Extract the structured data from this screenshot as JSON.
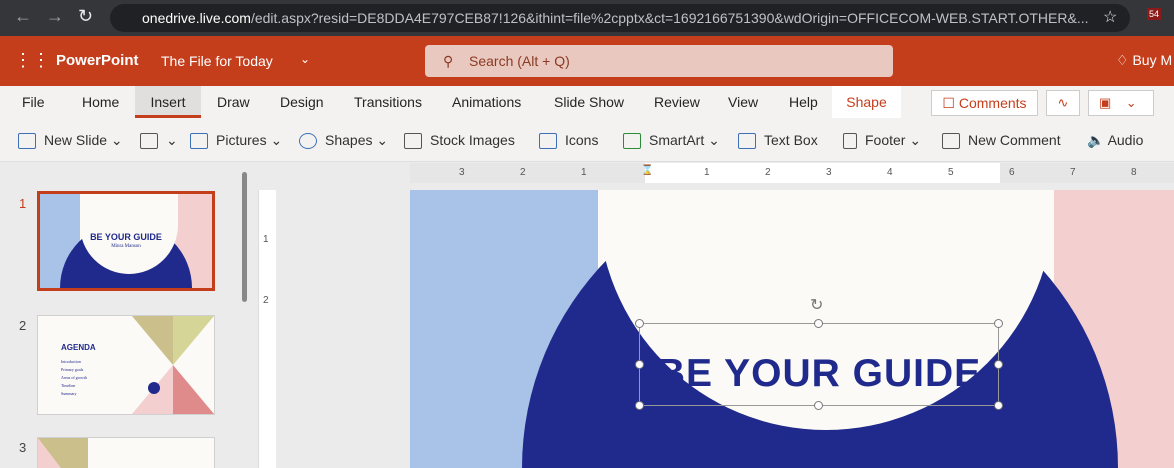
{
  "browser": {
    "url_host": "onedrive.live.com",
    "url_rest": "/edit.aspx?resid=DE8DDA4E797CEB87!126&ithint=file%2cpptx&ct=1692166751390&wdOrigin=OFFICECOM-WEB.START.OTHER&...",
    "ext_badge": "54"
  },
  "app": {
    "name": "PowerPoint",
    "file_title": "The File for Today",
    "search_placeholder": "Search (Alt + Q)",
    "buy": "Buy M"
  },
  "tabs": [
    "File",
    "Home",
    "Insert",
    "Draw",
    "Design",
    "Transitions",
    "Animations",
    "Slide Show",
    "Review",
    "View",
    "Help",
    "Shape"
  ],
  "comments_label": "Comments",
  "ribbon": [
    "New Slide",
    "Pictures",
    "Shapes",
    "Stock Images",
    "Icons",
    "SmartArt",
    "Text Box",
    "Footer",
    "New Comment",
    "Audio"
  ],
  "ruler": [
    "3",
    "2",
    "1",
    "1",
    "2",
    "3",
    "4",
    "5",
    "6",
    "7",
    "8"
  ],
  "vruler": [
    "1",
    "2"
  ],
  "thumbnails": [
    {
      "num": "1",
      "title": "BE YOUR GUIDE",
      "subtitle": "Minra Manson"
    },
    {
      "num": "2",
      "title": "AGENDA",
      "items": [
        "Introduction",
        "Primary goals",
        "Areas of growth",
        "Timeline",
        "Summary"
      ]
    },
    {
      "num": "3"
    }
  ],
  "slide": {
    "title": "BE YOUR GUIDE",
    "subtitle": "Minra Manson"
  },
  "colors": {
    "accent": "#c43e1c",
    "navy": "#1f2a8c",
    "blue": "#a9c3e8",
    "pink": "#f4cfcf",
    "cream": "#fcfaf6"
  }
}
